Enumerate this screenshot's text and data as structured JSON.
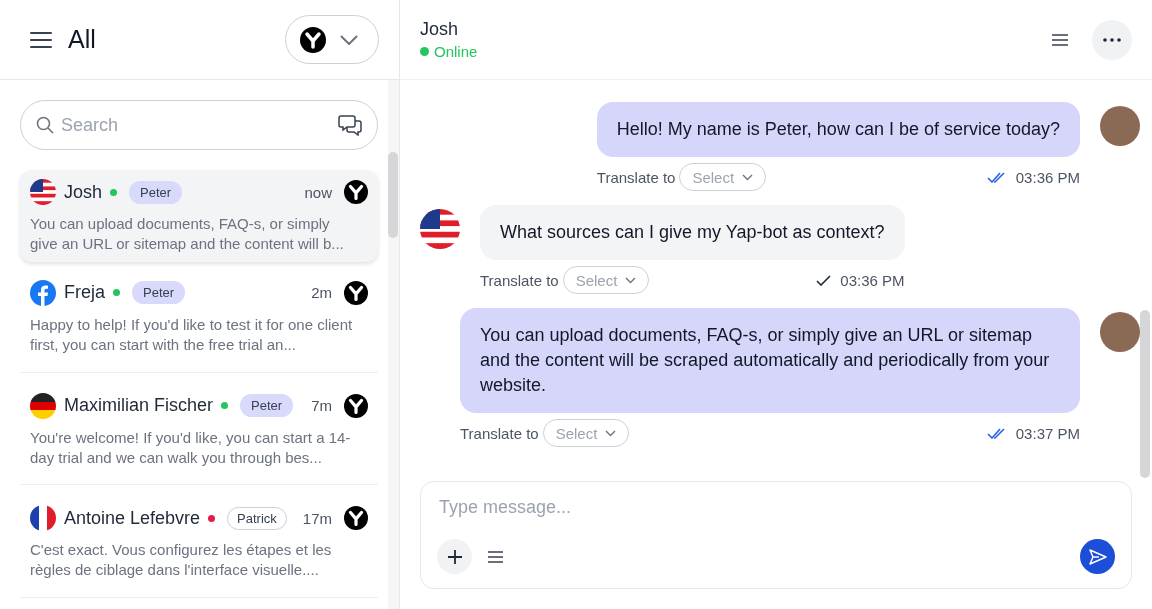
{
  "sidebar": {
    "title": "All",
    "search": {
      "placeholder": "Search"
    },
    "conversations": [
      {
        "kind": "us",
        "name": "Josh",
        "color": "#22c55e",
        "tag": {
          "label": "Peter",
          "kind": "filled"
        },
        "time": "now",
        "preview": "You can upload documents, FAQ-s, or simply give an URL or sitemap and the content will b...",
        "selected": true
      },
      {
        "kind": "facebook",
        "name": "Freja",
        "color": "#22c55e",
        "tag": {
          "label": "Peter",
          "kind": "filled"
        },
        "time": "2m",
        "preview": "Happy to help! If you'd like to test it for one client first, you can start with the free trial an...",
        "selected": false
      },
      {
        "kind": "de",
        "name": "Maximilian Fischer",
        "color": "#22c55e",
        "tag": {
          "label": "Peter",
          "kind": "filled"
        },
        "time": "7m",
        "preview": "You're welcome! If you'd like, you can start a 14-day trial and we can walk you through bes...",
        "selected": false
      },
      {
        "kind": "fr",
        "name": "Antoine Lefebvre",
        "color": "#e11d48",
        "tag": {
          "label": "Patrick",
          "kind": "outlined"
        },
        "time": "17m",
        "preview": "C'est exact. Vous configurez les étapes et les règles de ciblage dans l'interface visuelle....",
        "selected": false
      }
    ]
  },
  "chat": {
    "name": "Josh",
    "status": "Online",
    "messages": [
      {
        "kind": "agent",
        "text": "Hello! My name is Peter, how can I be of service today?",
        "translate_label": "Translate to",
        "translate_placeholder": "Select",
        "read": true,
        "time": "03:36 PM"
      },
      {
        "kind": "visitor",
        "text": "What sources can I give my Yap-bot as context?",
        "translate_label": "Translate to",
        "translate_placeholder": "Select",
        "read": false,
        "time": "03:36 PM"
      },
      {
        "kind": "agent",
        "text": "You can upload documents, FAQ-s, or simply give an URL or sitemap and the content will be scraped automatically and periodically from your website.",
        "translate_label": "Translate to",
        "translate_placeholder": "Select",
        "read": true,
        "time": "03:37 PM"
      }
    ],
    "composer": {
      "placeholder": "Type message..."
    }
  }
}
